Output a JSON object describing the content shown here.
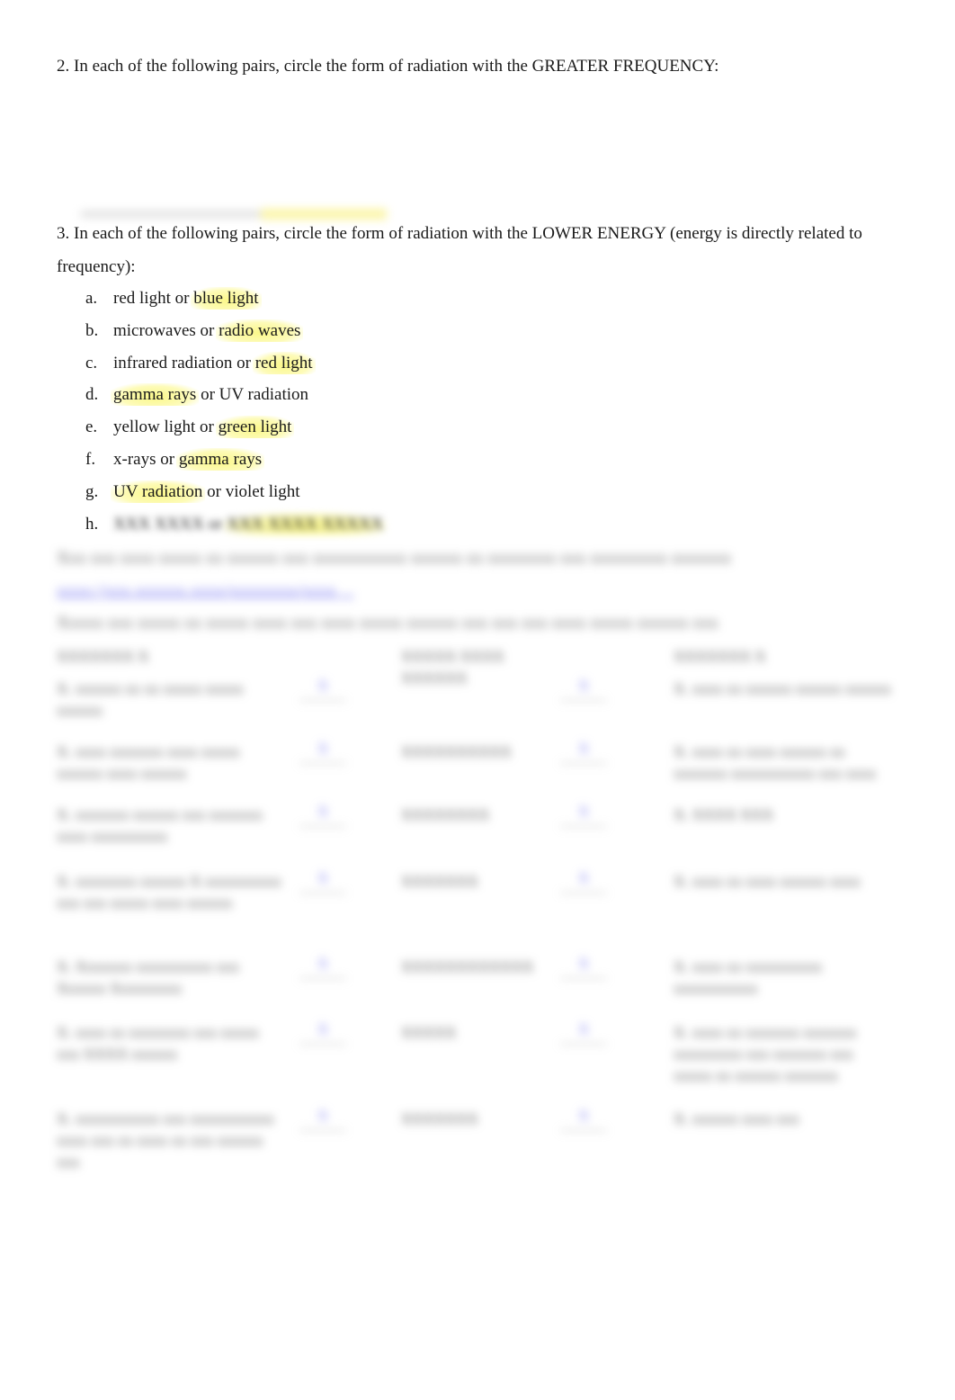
{
  "question2": {
    "text": "2. In each of the following pairs, circle the form of radiation with the GREATER FREQUENCY:"
  },
  "question3": {
    "text": "3. In each of the following pairs, circle the form of radiation with the LOWER ENERGY (energy is directly related to frequency):",
    "items": [
      {
        "label": "a.",
        "before": "red light or ",
        "highlighted": "blue light",
        "after": ""
      },
      {
        "label": "b.",
        "before": "microwaves or ",
        "highlighted": "radio waves",
        "after": ""
      },
      {
        "label": "c.",
        "before": "infrared radiation or ",
        "highlighted": "red light",
        "after": ""
      },
      {
        "label": "d.",
        "before": "",
        "highlighted": "gamma rays",
        "after": " or UV radiation"
      },
      {
        "label": "e.",
        "before": "yellow light or ",
        "highlighted": "green light",
        "after": ""
      },
      {
        "label": "f.",
        "before": "x-rays or ",
        "highlighted": "gamma rays",
        "after": ""
      },
      {
        "label": "g.",
        "before": "",
        "highlighted": "UV radiation",
        "after": " or violet light"
      },
      {
        "label": "h.",
        "before": "XXX XXXX or ",
        "highlighted": "XXX XXXX XXXXX",
        "after": ""
      }
    ]
  },
  "obscured": {
    "instruction": "Xxx xxx xxxx xxxxx xx xxxxxx xxx xxxxxxxxxxx xxxxxx xx xxxxxxxx xxx xxxxxxxxx xxxxxxx",
    "link": "xxxx://xxx.xxxxxx.xxxx/xxxxxxxx/xxxx ...",
    "prompt": "Xxxxx xxx xxxxx xx xxxxx xxxx xxx xxxx xxxxx xxxxxx xxx xxx xxx xxxx xxxxx xxxxxx xxx",
    "header": {
      "left": "XXXXXXX X",
      "mid": "XXXXX XXXX XXXXXX",
      "right": "XXXXXXX X"
    },
    "rows": [
      {
        "left": "X. xxxxxx xx xx xxxxx xxxxx xxxxxx",
        "blank_a": "X",
        "mid": "",
        "blank_b": "X",
        "right": "X. xxxx xx xxxxxx xxxxxx xxxxxx"
      },
      {
        "left": "X. xxxx xxxxxxx xxxx xxxxx xxxxxx xxxx xxxxxx",
        "blank_a": "X",
        "mid": "XXXXXXXXXX",
        "blank_b": "X",
        "right": "X. xxxx xx xxxx xxxxxx xx xxxxxxx xxxxxxxxxxx xxx xxxx"
      },
      {
        "left": "X. xxxxxxx xxxxxx xxx xxxxxxx xxxx xxxxxxxxxx",
        "blank_a": "X",
        "mid": "XXXXXXXX",
        "blank_b": "X",
        "right": "X. XXXX XXX"
      },
      {
        "left": "X. xxxxxxxx xxxxxx X xxxxxxxxxx xxx xxx xxxxx xxxx xxxxxx",
        "blank_a": "X",
        "mid": "XXXXXXX",
        "blank_b": "X",
        "right": "X. xxxx xx xxxx xxxxxx xxxx"
      },
      {
        "left": "X. Xxxxxxx xxxxxxxxxx xxx Xxxxxx Xxxxxxxxx",
        "blank_a": "X",
        "mid": "XXXXXXXXXXXX",
        "blank_b": "X",
        "right": "X. xxxx xx xxxxxxxxxx xxxxxxxxxxx"
      },
      {
        "left": "X. xxxx xx xxxxxxxx xxx xxxxx xxx XXXX xxxxxx",
        "blank_a": "X",
        "mid": "XXXXX",
        "blank_b": "X",
        "right": "X. xxxx xx xxxxxxx xxxxxxx xxxxxxxxx xxx xxxxxxx xxx xxxxx xx xxxxxx xxxxxxx"
      },
      {
        "left": "X. xxxxxxxxxxx xxx xxxxxxxxxxx xxxx xxx xx xxxx xx xxx xxxxxx xxx",
        "blank_a": "X",
        "mid": "XXXXXXX",
        "blank_b": "X",
        "right": "X. xxxxxx xxxx xxx"
      }
    ]
  },
  "colors": {
    "highlight": "#fbf88a",
    "text": "#1a1a1a",
    "link": "#6f6ff0"
  }
}
